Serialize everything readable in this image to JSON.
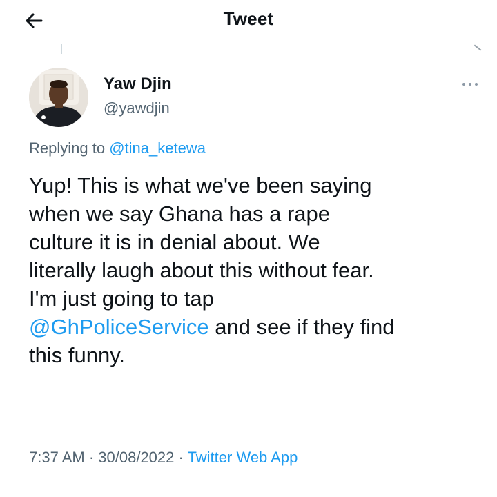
{
  "header": {
    "title": "Tweet"
  },
  "icons": {
    "back": "arrow-left-icon",
    "more": "more-horizontal-icon"
  },
  "author": {
    "name": "Yaw Djin",
    "handle": "@yawdjin"
  },
  "replying": {
    "prefix": "Replying to ",
    "mention": "@tina_ketewa"
  },
  "tweet": {
    "line1": "Yup! This is what we've been saying",
    "line2": "when we say Ghana has a rape",
    "line3": "culture it is in denial about. We",
    "line4": "literally laugh about this without fear.",
    "line5": "I'm just going to tap",
    "mention": "@GhPoliceService",
    "line6_rest": " and see if they find",
    "line7": "this funny."
  },
  "meta": {
    "time": "7:37 AM",
    "separator": " · ",
    "date": "30/08/2022",
    "source": "Twitter Web App"
  },
  "colors": {
    "link": "#1d9bf0",
    "text": "#0f1419",
    "secondary": "#536471"
  }
}
